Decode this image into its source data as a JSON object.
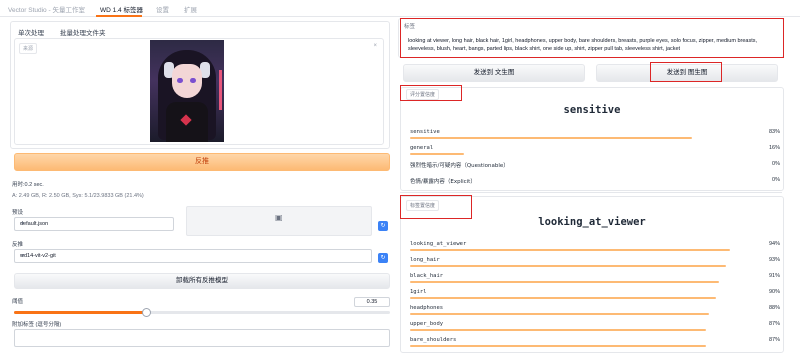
{
  "topnav": {
    "tabs": [
      "Vector Studio - 矢量工作室",
      "WD 1.4 标签器",
      "设置",
      "扩展"
    ],
    "active_index": 1
  },
  "left": {
    "subtabs": [
      "单次处理",
      "批量处理文件夹"
    ],
    "image_label": "来源",
    "close_glyph": "×",
    "interrogate_label": "反推",
    "time_text": "用时:0.2 sec.",
    "memory_text": "A: 2.49 GB, R: 2.50 GB, Sys: 5.1/23.9833 GB (21.4%)",
    "preset_label": "预设",
    "preset_value": "default.json",
    "interrogator_label": "反推",
    "interrogator_value": "wd14-vit-v2-git",
    "unload_label": "卸载所有反推模型",
    "threshold_label": "阈值",
    "threshold_value": "0.35",
    "threshold_fraction": 0.35,
    "extra_tags_label": "附加标签 (逗号分隔)"
  },
  "right": {
    "tags_label": "标签",
    "tags_text": "looking at viewer, long hair, black hair, 1girl, headphones, upper body, bare shoulders, breasts, purple eyes, solo focus, zipper, medium breasts, sleeveless, blush, heart, bangs, parted lips, black shirt, one side up, shirt, zipper pull tab, sleeveless shirt, jacket",
    "send_txt2img": "发送到 文生图",
    "send_img2img": "发送到 图生图",
    "rating_chip": "评分置信度",
    "rating_title": "sensitive",
    "ratings": [
      {
        "label": "sensitive",
        "pct": "83%",
        "value": 0.83
      },
      {
        "label": "general",
        "pct": "16%",
        "value": 0.16
      },
      {
        "label": "强烈性暗示/可疑内容（Questionable）",
        "pct": "0%",
        "value": 0.0
      },
      {
        "label": "色情/暴露内容（Explicit）",
        "pct": "0%",
        "value": 0.0
      }
    ],
    "tag_chip": "标签置信度",
    "tag_title": "looking_at_viewer",
    "tags": [
      {
        "label": "looking_at_viewer",
        "pct": "94%",
        "value": 0.94
      },
      {
        "label": "long_hair",
        "pct": "93%",
        "value": 0.93
      },
      {
        "label": "black_hair",
        "pct": "91%",
        "value": 0.91
      },
      {
        "label": "1girl",
        "pct": "90%",
        "value": 0.9
      },
      {
        "label": "headphones",
        "pct": "88%",
        "value": 0.88
      },
      {
        "label": "upper_body",
        "pct": "87%",
        "value": 0.87
      },
      {
        "label": "bare_shoulders",
        "pct": "87%",
        "value": 0.87
      }
    ]
  },
  "colors": {
    "accent": "#f97316",
    "highlight": "#dc2626",
    "bar": "#fdba74",
    "primary_button": "#3b82f6"
  }
}
